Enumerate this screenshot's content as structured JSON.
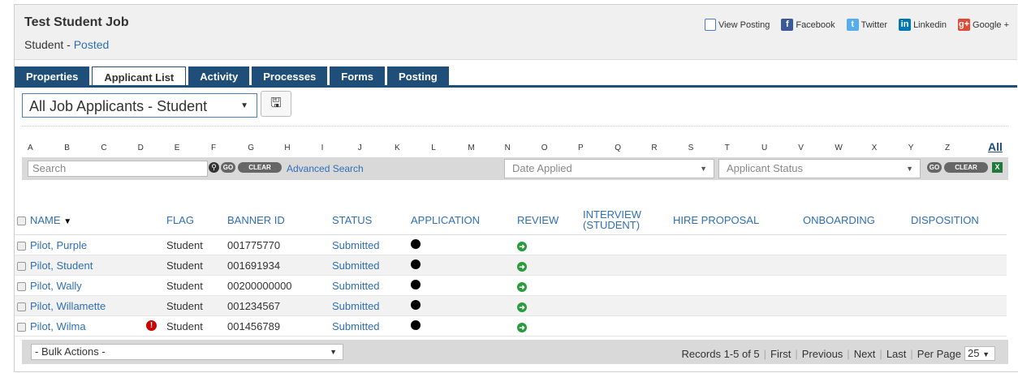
{
  "job": {
    "title": "Test Student Job",
    "type": "Student",
    "separator": " - ",
    "state": "Posted"
  },
  "share": [
    {
      "name": "view-posting-icon",
      "label": "View Posting",
      "glyph": ""
    },
    {
      "name": "facebook-icon",
      "label": "Facebook",
      "glyph": "f"
    },
    {
      "name": "twitter-icon",
      "label": "Twitter",
      "glyph": "t"
    },
    {
      "name": "linkedin-icon",
      "label": "Linkedin",
      "glyph": "in"
    },
    {
      "name": "googleplus-icon",
      "label": "Google +",
      "glyph": "g+"
    }
  ],
  "tabs": [
    "Properties",
    "Applicant List",
    "Activity",
    "Processes",
    "Forms",
    "Posting"
  ],
  "active_tab": "Applicant List",
  "view_select": {
    "value": "All Job Applicants - Student"
  },
  "alphabet": [
    "A",
    "B",
    "C",
    "D",
    "E",
    "F",
    "G",
    "H",
    "I",
    "J",
    "K",
    "L",
    "M",
    "N",
    "O",
    "P",
    "Q",
    "R",
    "S",
    "T",
    "U",
    "V",
    "W",
    "X",
    "Y",
    "Z"
  ],
  "alpha_all": "All",
  "filter": {
    "search_placeholder": "Search",
    "go": "GO",
    "clear": "CLEAR",
    "advanced": "Advanced Search",
    "date_applied": "Date Applied",
    "applicant_status": "Applicant Status"
  },
  "columns": {
    "name": "NAME",
    "flag": "FLAG",
    "banner": "BANNER ID",
    "status": "STATUS",
    "application": "APPLICATION",
    "review": "REVIEW",
    "interview": "INTERVIEW",
    "interview_sub": "(STUDENT)",
    "hire": "HIRE PROPOSAL",
    "onboarding": "ONBOARDING",
    "disposition": "DISPOSITION"
  },
  "rows": [
    {
      "name": "Pilot, Purple",
      "flag": "Student",
      "alert": false,
      "banner": "001775770",
      "status": "Submitted"
    },
    {
      "name": "Pilot, Student",
      "flag": "Student",
      "alert": false,
      "banner": "001691934",
      "status": "Submitted"
    },
    {
      "name": "Pilot, Wally",
      "flag": "Student",
      "alert": false,
      "banner": "00200000000",
      "status": "Submitted"
    },
    {
      "name": "Pilot, Willamette",
      "flag": "Student",
      "alert": false,
      "banner": "001234567",
      "status": "Submitted"
    },
    {
      "name": "Pilot, Wilma",
      "flag": "Student",
      "alert": true,
      "banner": "001456789",
      "status": "Submitted"
    }
  ],
  "footer": {
    "bulk": "- Bulk Actions -",
    "records": "Records 1-5 of 5",
    "first": "First",
    "previous": "Previous",
    "next": "Next",
    "last": "Last",
    "per_page": "Per Page",
    "per_page_value": "25"
  },
  "colors": {
    "tab": "#1f4e79",
    "link": "#2f6fb5",
    "review_ok": "#2a9b3c",
    "alert": "#cc0000"
  }
}
